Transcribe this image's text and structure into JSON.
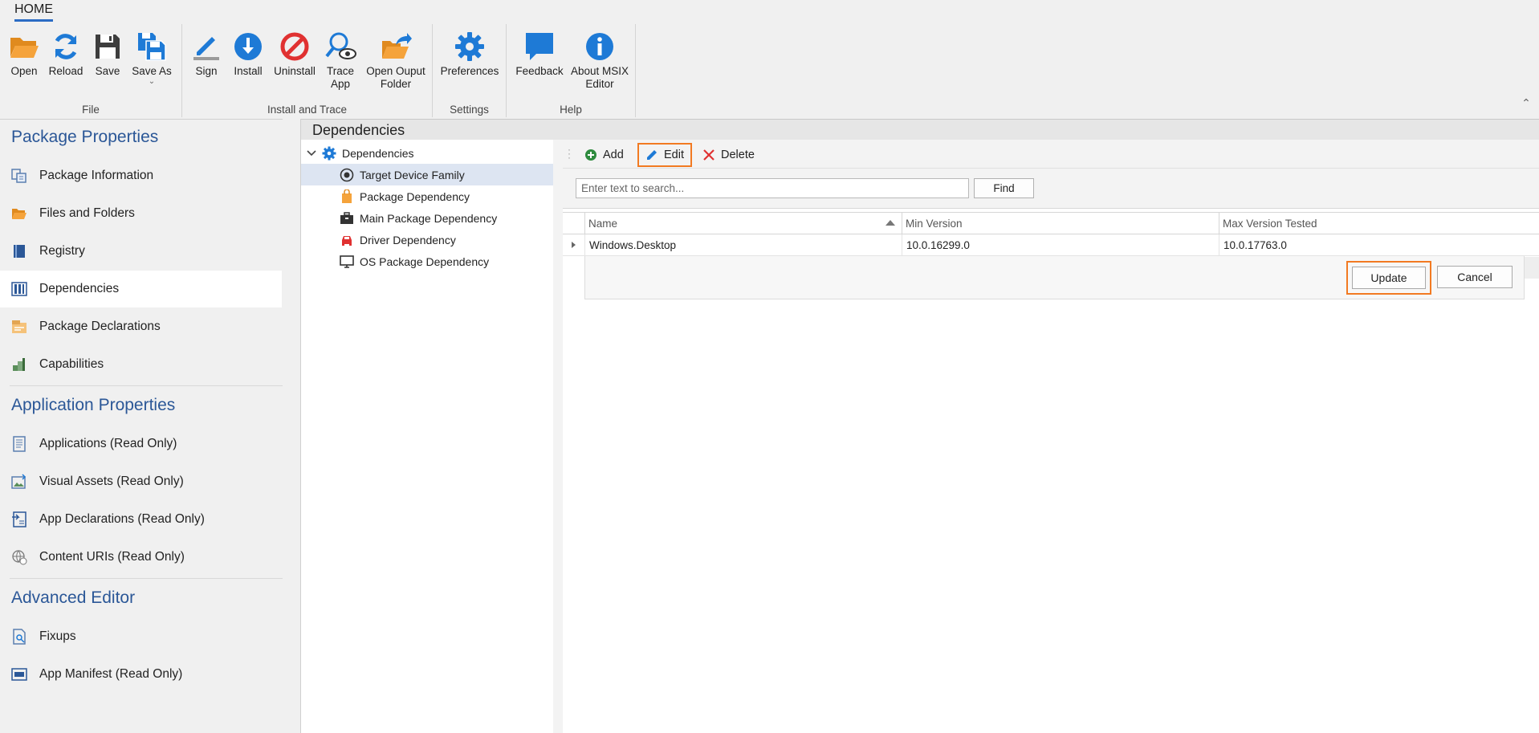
{
  "ribbon": {
    "tab": "HOME",
    "groups": {
      "file": {
        "label": "File",
        "buttons": [
          {
            "label": "Open",
            "icon": "folder-open-icon"
          },
          {
            "label": "Reload",
            "icon": "reload-icon"
          },
          {
            "label": "Save",
            "icon": "save-icon"
          },
          {
            "label": "Save As",
            "icon": "save-as-icon"
          }
        ]
      },
      "install": {
        "label": "Install and Trace",
        "buttons": [
          {
            "label": "Sign",
            "icon": "pen-icon"
          },
          {
            "label": "Install",
            "icon": "download-icon"
          },
          {
            "label": "Uninstall",
            "icon": "prohibited-icon"
          },
          {
            "label": "Trace",
            "label2": "App",
            "icon": "magnify-eye-icon"
          },
          {
            "label": "Open Ouput",
            "label2": "Folder",
            "icon": "folder-arrow-icon"
          }
        ]
      },
      "settings": {
        "label": "Settings",
        "buttons": [
          {
            "label": "Preferences",
            "icon": "gear-icon"
          }
        ]
      },
      "help": {
        "label": "Help",
        "buttons": [
          {
            "label": "Feedback",
            "icon": "speech-bubble-icon"
          },
          {
            "label": "About MSIX",
            "label2": "Editor",
            "icon": "info-icon"
          }
        ]
      }
    }
  },
  "nav": {
    "package_heading": "Package Properties",
    "package_items": [
      "Package Information",
      "Files and Folders",
      "Registry",
      "Dependencies",
      "Package Declarations",
      "Capabilities"
    ],
    "application_heading": "Application Properties",
    "application_items": [
      "Applications (Read Only)",
      "Visual Assets (Read Only)",
      "App Declarations (Read Only)",
      "Content URIs (Read Only)"
    ],
    "advanced_heading": "Advanced Editor",
    "advanced_items": [
      "Fixups",
      "App Manifest (Read Only)"
    ]
  },
  "content": {
    "title": "Dependencies",
    "tree": {
      "root": "Dependencies",
      "items": [
        "Target Device Family",
        "Package Dependency",
        "Main Package Dependency",
        "Driver Dependency",
        "OS Package Dependency"
      ]
    },
    "toolbar": {
      "add": "Add",
      "edit": "Edit",
      "delete": "Delete"
    },
    "search": {
      "placeholder": "Enter text to search...",
      "find": "Find"
    },
    "grid": {
      "columns": [
        "Name",
        "Min Version",
        "Max Version Tested"
      ],
      "rows": [
        [
          "Windows.Desktop",
          "10.0.16299.0",
          "10.0.17763.0"
        ]
      ],
      "update": "Update",
      "cancel": "Cancel"
    }
  },
  "colors": {
    "accent_blue": "#1e7ad6",
    "heading_blue": "#2b5797",
    "highlight_orange": "#f27a22",
    "folder_orange": "#f5a33b",
    "red": "#e03131",
    "green": "#2e8b3e"
  }
}
